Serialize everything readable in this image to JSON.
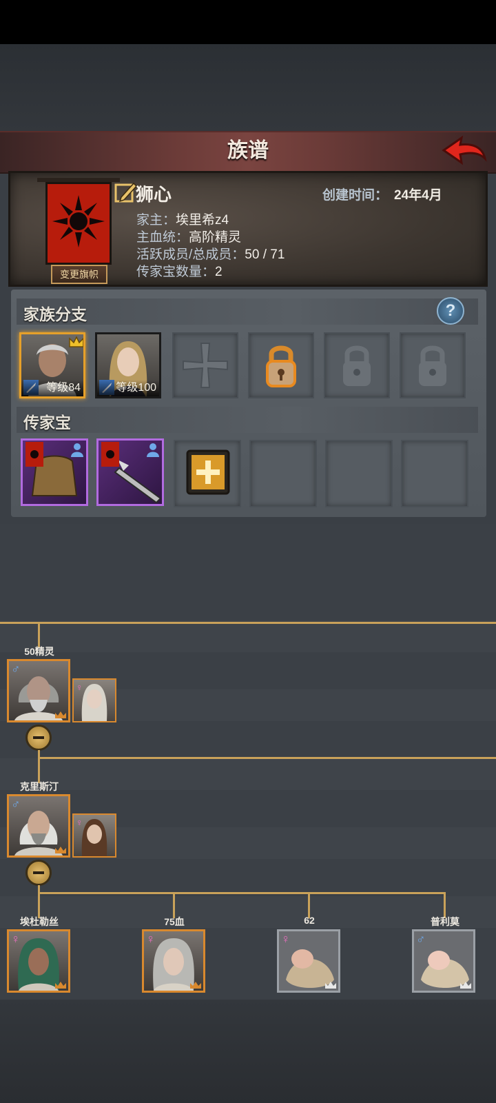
{
  "header": {
    "title": "族谱"
  },
  "family": {
    "name": "狮心",
    "created_label": "创建时间：",
    "created_value": "24年4月",
    "head_label": "家主：",
    "head_value": "埃里希z4",
    "blood_label": "主血统：",
    "blood_value": "高阶精灵",
    "members_label": "活跃成员/总成员：",
    "members_value": "50 / 71",
    "heirlooms_label": "传家宝数量：",
    "heirlooms_value": "2",
    "change_banner_label": "变更旗帜",
    "banner_color": "#b71c0c"
  },
  "branches": {
    "title": "家族分支",
    "help_label": "?",
    "slots": [
      {
        "level_text": "等级84",
        "state": "occupied-leader"
      },
      {
        "level_text": "等级100",
        "state": "occupied"
      },
      {
        "state": "empty-cross"
      },
      {
        "state": "unlockable-lock"
      },
      {
        "state": "locked"
      },
      {
        "state": "locked"
      }
    ]
  },
  "heirlooms": {
    "title": "传家宝",
    "slots": [
      {
        "type": "armor",
        "state": "equipped"
      },
      {
        "type": "spear",
        "state": "equipped"
      },
      {
        "state": "add"
      },
      {
        "state": "empty"
      },
      {
        "state": "empty"
      },
      {
        "state": "empty"
      }
    ]
  },
  "tree": {
    "gen1": {
      "name": "50精灵",
      "gender": "♂",
      "spouse_gender": "♀"
    },
    "gen2": {
      "name": "克里斯汀",
      "gender": "♂",
      "spouse_gender": "♀"
    },
    "children": [
      {
        "name": "埃杜勒丝",
        "gender": "♀"
      },
      {
        "name": "75血",
        "gender": "♀"
      },
      {
        "name": "62",
        "gender": "♀"
      },
      {
        "name": "普利莫",
        "gender": "♂"
      }
    ]
  },
  "colors": {
    "accent_gold": "#c9a25a",
    "frame_orange": "#d9892e",
    "heirloom_purple": "#b26be0"
  }
}
